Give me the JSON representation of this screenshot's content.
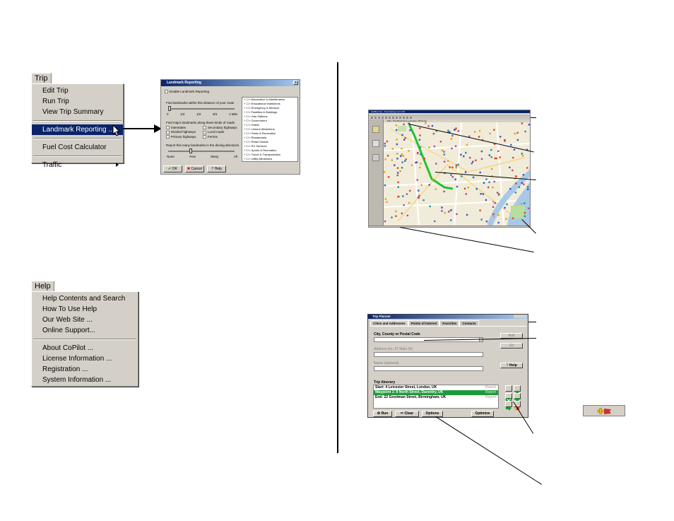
{
  "trip_menu": {
    "title": "Trip",
    "items": [
      "Edit Trip",
      "Run Trip",
      "View Trip Summary",
      "Landmark Reporting ...",
      "Fuel Cost Calculator",
      "Traffic"
    ]
  },
  "help_menu": {
    "title": "Help",
    "items": [
      "Help Contents and Search",
      "How To Use Help",
      "Our Web Site ...",
      "Online Support...",
      "About CoPilot ...",
      "License Information ...",
      "Registration ...",
      "System Information ..."
    ]
  },
  "landmark_dialog": {
    "title": "Landmark Reporting",
    "enable_label": "Enable Landmark Reporting",
    "distance_label": "Find landmarks within this distance of your route",
    "distance_ticks": [
      "0",
      "1/4",
      "1/2",
      "3/4",
      "1 Mile"
    ],
    "roads_label": "Find major landmarks along these kinds of roads",
    "roads": [
      "Interstates",
      "Secondary highways",
      "Divided highways",
      "Local roads",
      "Primary highways",
      "Ferries"
    ],
    "report_label": "Report this many landmarks in the driving directions",
    "report_ticks": [
      "None",
      "Few",
      "Many",
      "All"
    ],
    "categories": [
      "Automotive & Maintenance",
      "Educational Institutions",
      "Emergency & Medical",
      "Facilities & Buildings",
      "Gas Stations",
      "Government",
      "Hotels",
      "Leisure Attractions",
      "Parks & Recreation",
      "Restaurants",
      "Retail Outlets",
      "RV Services",
      "Sports & Recreation",
      "Travel & Transportation",
      "Utility Attractions"
    ],
    "ok_label": "OK",
    "cancel_label": "Cancel",
    "help_label": "Help"
  },
  "map_window": {
    "title": "CoPilot Live - Trip Itinerary Lon 1.00",
    "top_label": "Plan: Trip Planning (1 Leicester, GB Zone)"
  },
  "trip_planner": {
    "title": "Trip Planner",
    "tabs": [
      "Cities and Addresses",
      "Points of Interest",
      "Favorites",
      "Contacts"
    ],
    "city_label": "City, County or Postal Code",
    "address_label": "Address (ex. 67 Main St)",
    "name_label": "Name (optional)",
    "add_label": "Add",
    "go_label": "Go",
    "help_label": "Help",
    "itinerary_label": "Trip Itinerary",
    "itinerary": [
      {
        "text": "Start: 4 Leicester Street, London, UK",
        "report": "Report"
      },
      {
        "text": "Waypoint 1: 8 North Street, Daventry, UK",
        "report": "Report"
      },
      {
        "text": "End: 22 Goodman Street, Birmingham, UK",
        "report": "Report"
      }
    ],
    "run_label": "Run",
    "clear_label": "Clear",
    "options_label": "Options",
    "optimize_label": "Optimize"
  },
  "colors": {
    "menu_bg": "#d4d0c8",
    "menu_select": "#0a246a",
    "route": "#22c22e",
    "itinerary_select": "#1f9a3b"
  }
}
